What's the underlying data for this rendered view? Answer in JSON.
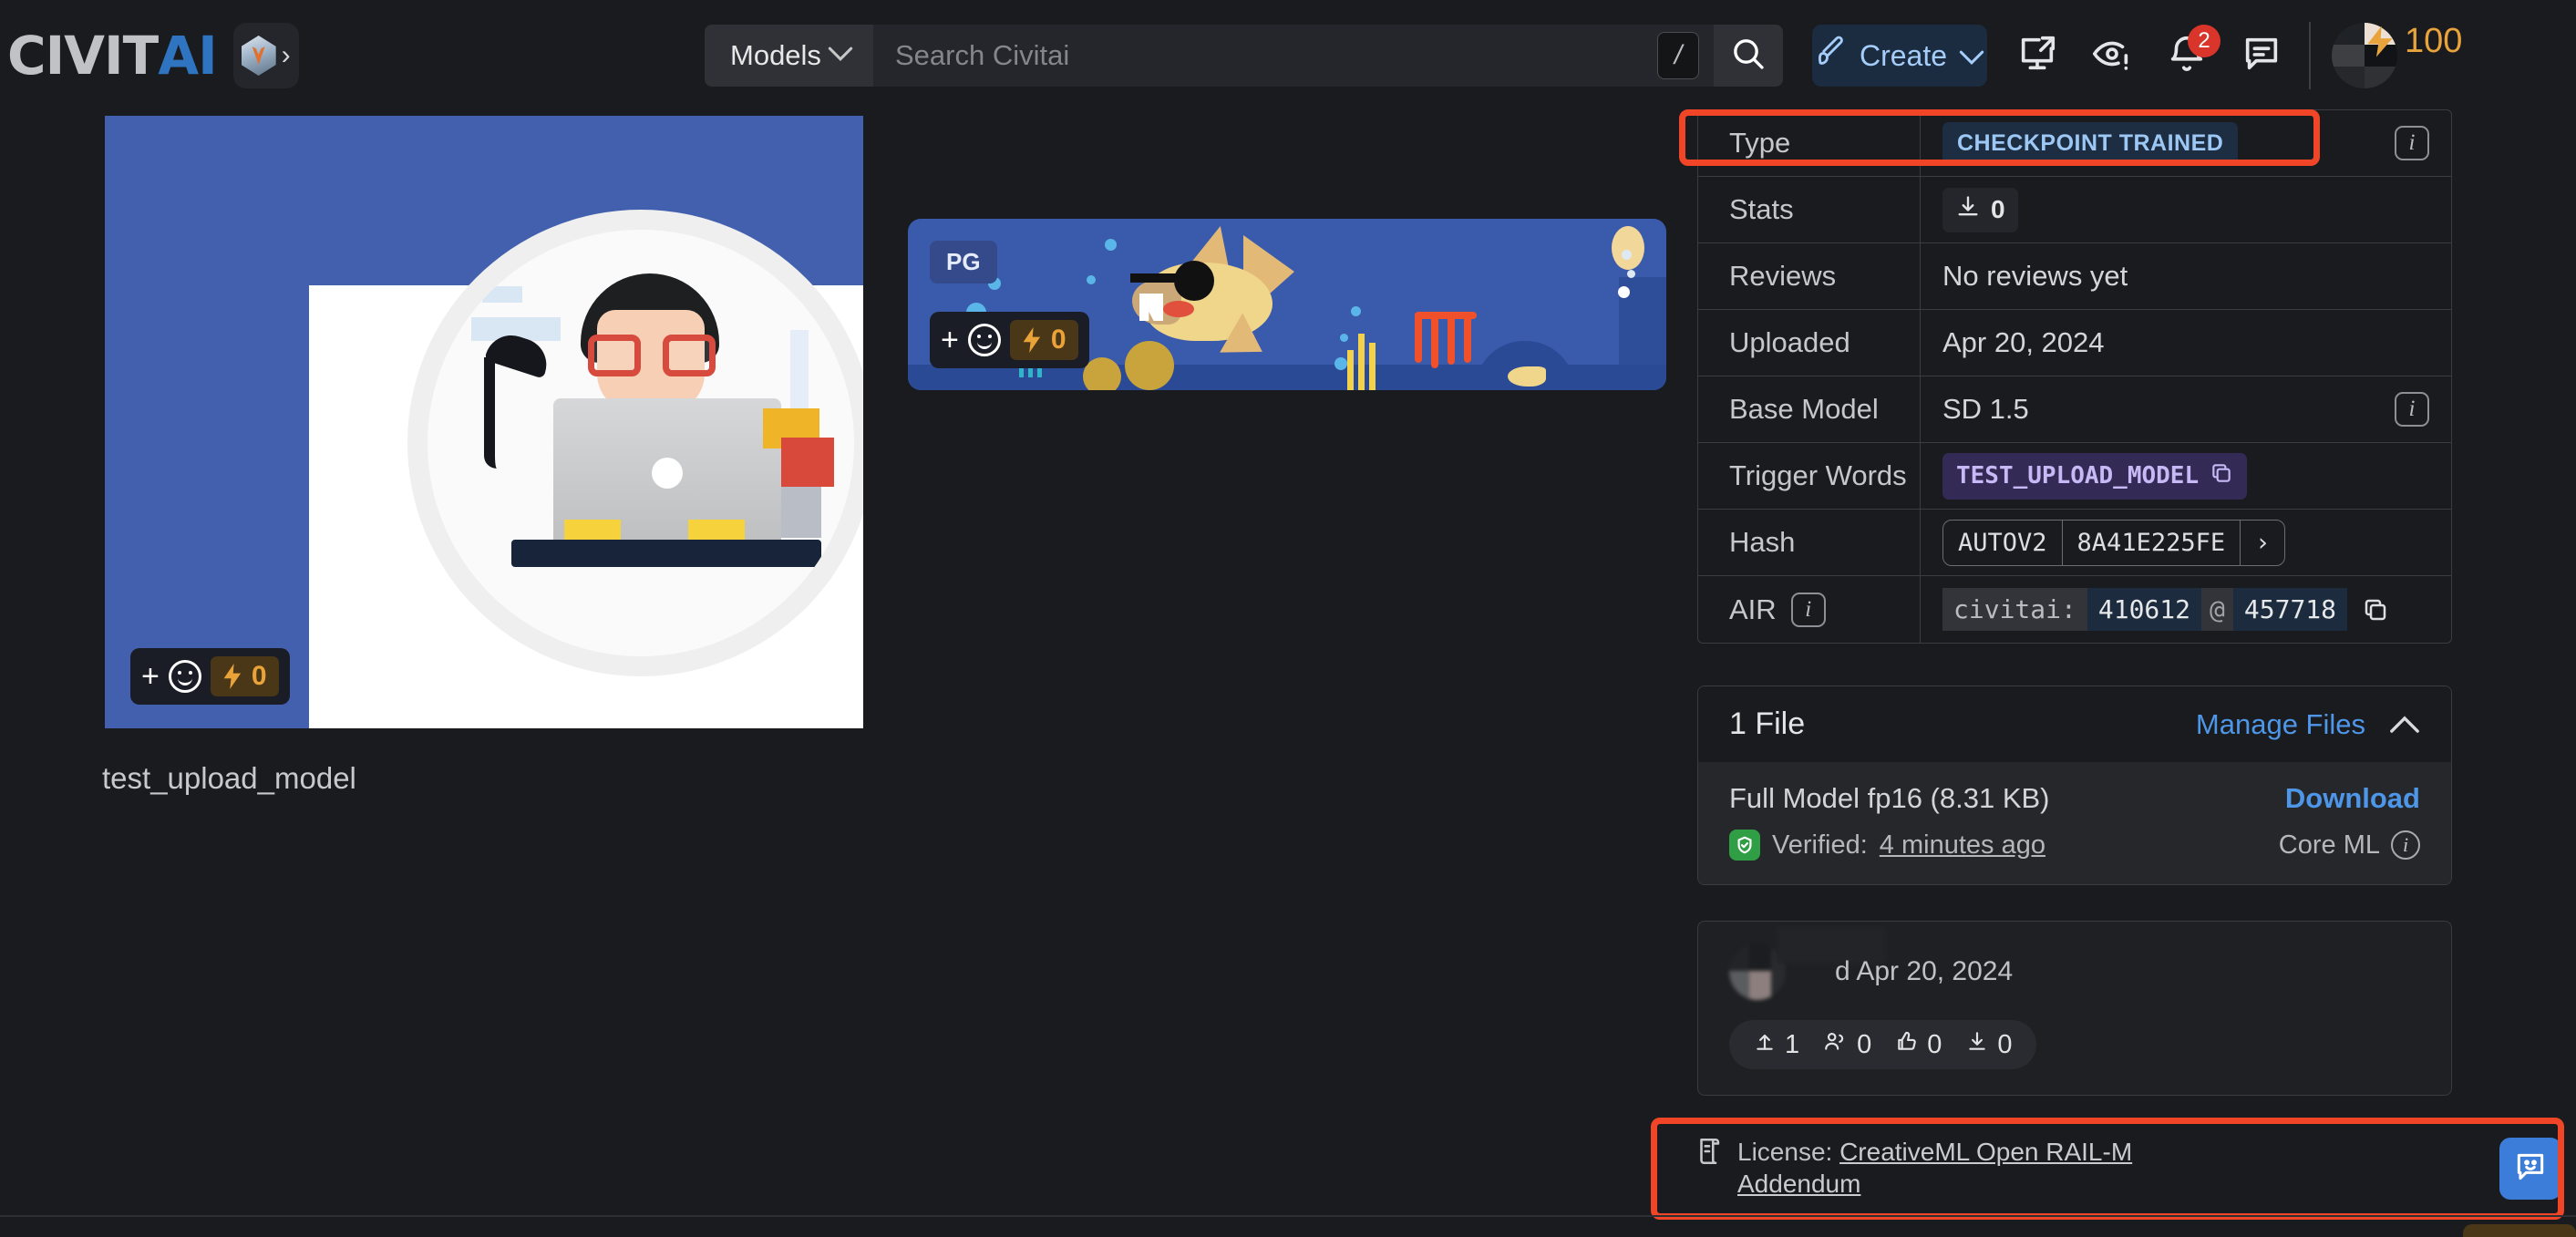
{
  "header": {
    "logo_civit": "CIVIT",
    "logo_ai": "AI",
    "logo_chevron": "›",
    "search": {
      "scope_label": "Models",
      "scope_chevron": "⌄",
      "placeholder": "Search Civitai",
      "value": "",
      "shortcut_key": "/"
    },
    "create_label": "Create",
    "create_chevron": "⌄",
    "notification_count": "2",
    "buzz_balance": "100"
  },
  "gallery": {
    "image1": {
      "buzz_count": "0",
      "plus": "+"
    },
    "image2": {
      "rating_badge": "PG",
      "buzz_count": "0",
      "plus": "+"
    },
    "model_name": "test_upload_model"
  },
  "details": {
    "rows": [
      {
        "key": "Type",
        "value_kind": "chip-type",
        "value": "CHECKPOINT TRAINED",
        "has_info": true
      },
      {
        "key": "Stats",
        "value_kind": "chip-stat",
        "value": "0",
        "has_info": false
      },
      {
        "key": "Reviews",
        "value_kind": "text",
        "value": "No reviews yet",
        "has_info": false
      },
      {
        "key": "Uploaded",
        "value_kind": "text",
        "value": "Apr 20, 2024",
        "has_info": false
      },
      {
        "key": "Base Model",
        "value_kind": "text",
        "value": "SD 1.5",
        "has_info": true
      },
      {
        "key": "Trigger Words",
        "value_kind": "chip-trigger",
        "value": "TEST_UPLOAD_MODEL",
        "has_info": false
      },
      {
        "key": "Hash",
        "value_kind": "hash",
        "value": "",
        "has_info": false
      },
      {
        "key": "AIR",
        "value_kind": "air",
        "value": "",
        "has_info": false
      }
    ],
    "hash": {
      "algo": "AUTOV2",
      "digest": "8A41E225FE",
      "expand_chevron": "›"
    },
    "air": {
      "prefix": "civitai:",
      "model_id": "410612",
      "at": "@",
      "version_id": "457718"
    },
    "air_label": "AIR"
  },
  "files": {
    "title": "1 File",
    "manage_label": "Manage Files",
    "collapse_chevron": "⌃",
    "name": "Full Model fp16 (8.31 KB)",
    "download_label": "Download",
    "verified_prefix": "Verified:",
    "verified_time": "4 minutes ago",
    "format_label": "Core ML"
  },
  "creator": {
    "date_text": "d Apr 20, 2024",
    "stats": [
      {
        "icon": "upload-icon",
        "value": "1"
      },
      {
        "icon": "followers-icon",
        "value": "0"
      },
      {
        "icon": "thumbup-icon",
        "value": "0"
      },
      {
        "icon": "download-icon",
        "value": "0"
      }
    ]
  },
  "license": {
    "prefix": "License:",
    "link_line1": "CreativeML Open RAIL-M",
    "link_line2": "Addendum"
  },
  "colors": {
    "page_bg": "#1a1b1e",
    "accent_blue": "#4e96e8",
    "annotation_red": "#f04527",
    "buzz_orange": "#e8a33d",
    "trigger_purple": "#c6b9f5",
    "verified_green": "#2f9e44"
  }
}
